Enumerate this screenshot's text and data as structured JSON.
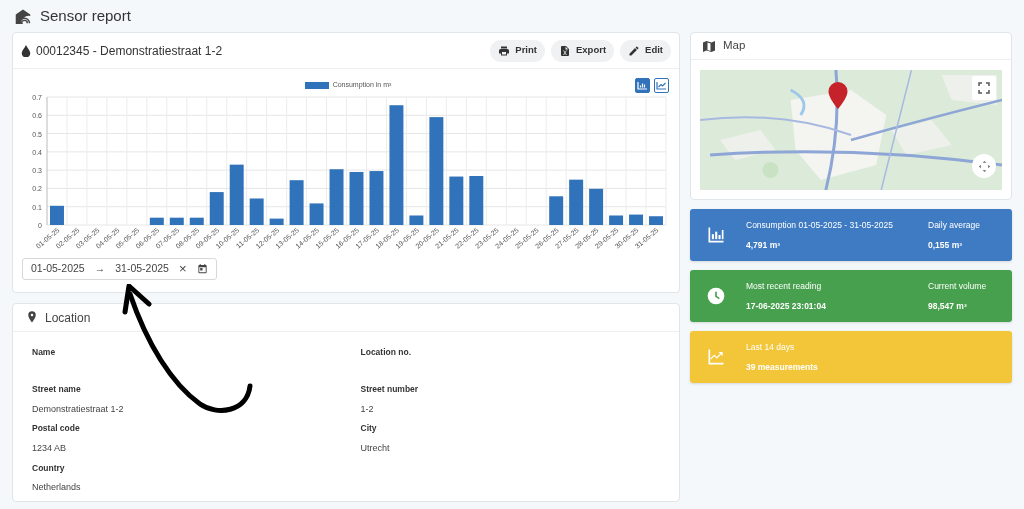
{
  "page": {
    "title": "Sensor report"
  },
  "sensor_card": {
    "title": "00012345 - Demonstratiestraat 1-2",
    "actions": [
      "Print",
      "Export",
      "Edit"
    ],
    "view_toggles": [
      {
        "selected": true
      },
      {
        "selected": false
      }
    ],
    "chart_data": {
      "type": "bar",
      "categories": [
        "01-05-25",
        "02-05-25",
        "03-05-25",
        "04-05-25",
        "05-05-25",
        "06-05-25",
        "07-05-25",
        "08-05-25",
        "09-05-25",
        "10-05-25",
        "11-05-25",
        "12-05-25",
        "13-05-25",
        "14-05-25",
        "15-05-25",
        "16-05-25",
        "17-05-25",
        "18-05-25",
        "19-05-25",
        "20-05-25",
        "21-05-25",
        "22-05-25",
        "23-05-25",
        "24-05-25",
        "25-05-25",
        "26-05-25",
        "27-05-25",
        "28-05-25",
        "29-05-25",
        "30-05-25",
        "31-05-25"
      ],
      "series": [
        {
          "name": "Consumption in m³",
          "color": "#3173ba",
          "values": [
            0.105,
            0,
            0,
            0,
            0,
            0.04,
            0.04,
            0.04,
            0.18,
            0.33,
            0.145,
            0.035,
            0.245,
            0.118,
            0.305,
            0.29,
            0.295,
            0.655,
            0.052,
            0.59,
            0.265,
            0.268,
            0,
            0,
            0,
            0.157,
            0.248,
            0.198,
            0.052,
            0.057,
            0.048
          ]
        }
      ],
      "grid": true,
      "ylim": [
        0,
        0.7
      ],
      "yticks": [
        0,
        0.1,
        0.2,
        0.3,
        0.4,
        0.5,
        0.6,
        0.7
      ]
    },
    "date_range": {
      "start": "01-05-2025",
      "separator": "→",
      "end": "31-05-2025",
      "clear": "×"
    }
  },
  "location": {
    "title": "Location",
    "fields": [
      {
        "label": "Name"
      },
      {
        "label": "Location no."
      },
      {
        "label": "Street name",
        "value": "Demonstratiestraat 1-2"
      },
      {
        "label": "Street number",
        "value": "1-2"
      },
      {
        "label": "Postal code",
        "value": "1234 AB"
      },
      {
        "label": "City",
        "value": "Utrecht"
      },
      {
        "label": "Country",
        "value": "Netherlands"
      }
    ]
  },
  "map": {
    "title": "Map"
  },
  "stats": [
    {
      "color": "#3f7bc2",
      "items": [
        {
          "label": "Consumption 01-05-2025 - 31-05-2025",
          "value": "4,791 m³"
        },
        {
          "label": "Daily average",
          "value": "0,155 m³"
        }
      ]
    },
    {
      "color": "#47a04d",
      "items": [
        {
          "label": "Most recent reading",
          "value": "17-06-2025 23:01:04"
        },
        {
          "label": "Current volume",
          "value": "98,547 m³"
        }
      ]
    },
    {
      "color": "#f3c63a",
      "items": [
        {
          "label": "Last 14 days",
          "value": "39 measurements"
        }
      ]
    }
  ]
}
